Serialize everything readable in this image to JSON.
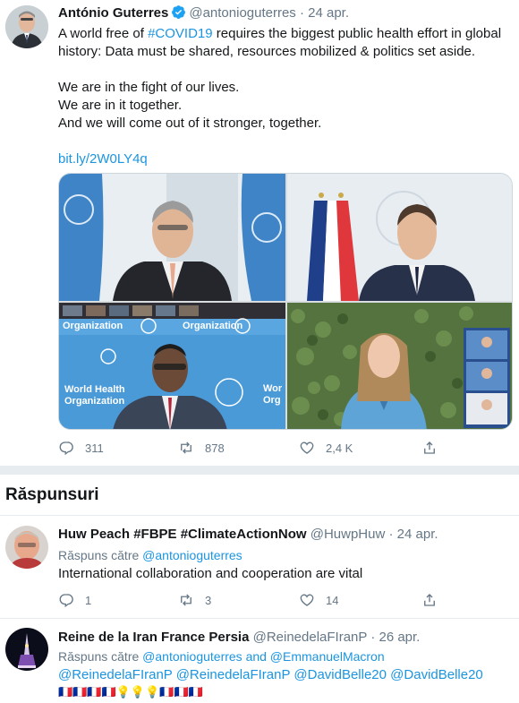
{
  "main_tweet": {
    "name": "António Guterres",
    "handle": "@antonioguterres",
    "date": "· 24 apr.",
    "text_prefix": "A world free of ",
    "hashtag": "#COVID19",
    "text_line1_rest": " requires the biggest public health effort in global",
    "text_line2": "history: Data must be shared, resources mobilized & politics set aside.",
    "text_line3": "We are in the fight of our lives.",
    "text_line4": "We are in it together.",
    "text_line5": "And we will come out of it stronger, together.",
    "link": "bit.ly/2W0LY4q",
    "media_captions": {
      "who_banner": "Organization",
      "who_banner_2": "Organization",
      "who_side_1": "World Health",
      "who_side_2": "Organization",
      "who_right_1": "Wor",
      "who_right_2": "Org"
    },
    "actions": {
      "reply_count": "311",
      "retweet_count": "878",
      "like_count": "2,4 K"
    }
  },
  "replies_section": {
    "title": "Răspunsuri"
  },
  "replies": [
    {
      "name": "Huw Peach #FBPE #ClimateActionNow",
      "handle": "@HuwpHuw",
      "date": "· 24 apr.",
      "reply_to_prefix": "Răspuns către ",
      "reply_to_handles": "@antonioguterres",
      "text": "International collaboration and cooperation are vital",
      "reply_count": "1",
      "retweet_count": "3",
      "like_count": "14"
    },
    {
      "name": "Reine de la Iran France Persia",
      "handle": "@ReinedelaFIranP",
      "date": "· 26 apr.",
      "reply_to_prefix": "Răspuns către ",
      "reply_to_handles": "@antonioguterres and @EmmanuelMacron",
      "mentions": "@ReinedelaFIranP  @ReinedelaFIranP  @DavidBelle20  @DavidBelle20",
      "flags_line": "🇫🇷🇫🇷🇫🇷🇫🇷💡💡💡🇫🇷🇫🇷🇫🇷"
    }
  ],
  "colors": {
    "accent": "#1b95e0",
    "muted": "#657786",
    "verified": "#1da1f2",
    "separator": "#e6ecf0"
  },
  "icons": [
    "verified-badge-icon",
    "reply-icon",
    "retweet-icon",
    "like-icon",
    "share-icon"
  ]
}
